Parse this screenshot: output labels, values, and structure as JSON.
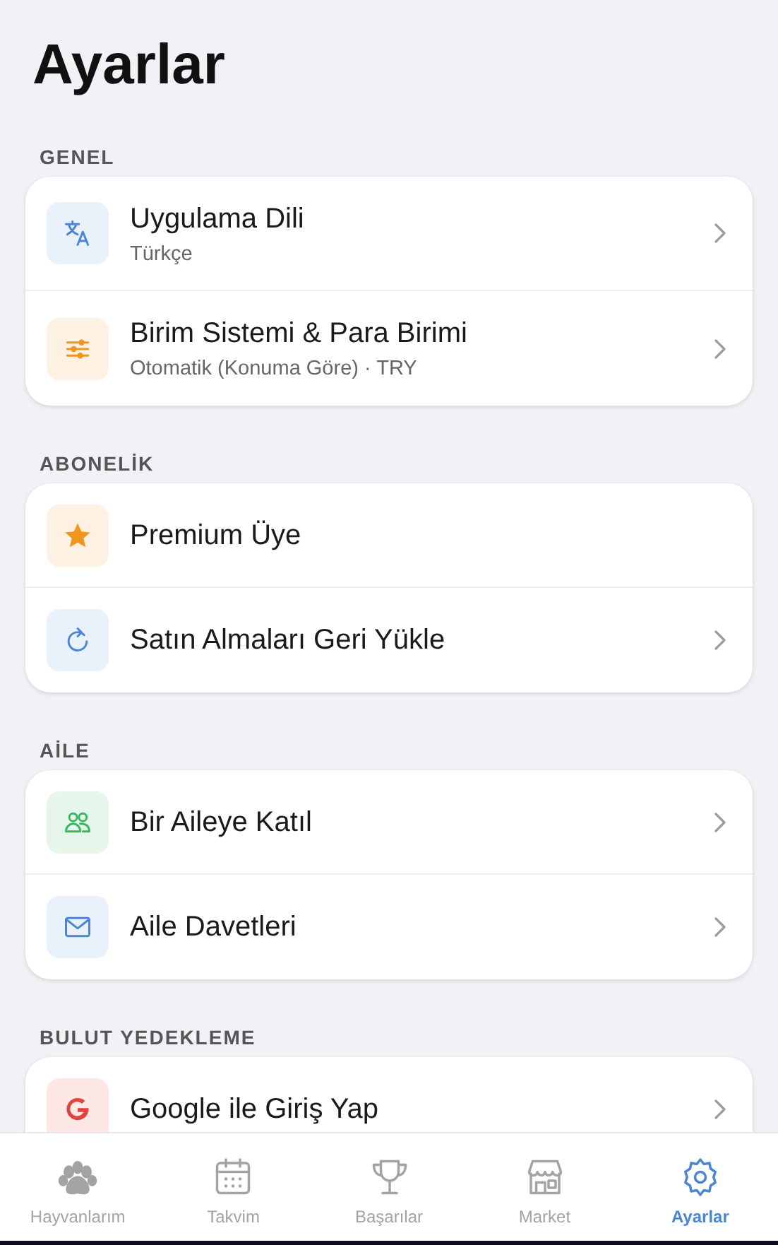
{
  "title": "Ayarlar",
  "sections": [
    {
      "header": "GENEL",
      "rows": [
        {
          "kind": "translate",
          "title": "Uygulama Dili",
          "subtitle": "Türkçe",
          "chevron": true
        },
        {
          "kind": "sliders",
          "title": "Birim Sistemi & Para Birimi",
          "subtitle": "Otomatik (Konuma Göre) · TRY",
          "chevron": true
        }
      ]
    },
    {
      "header": "ABONELİK",
      "rows": [
        {
          "kind": "star",
          "title": "Premium Üye",
          "chevron": false
        },
        {
          "kind": "refresh",
          "title": "Satın Almaları Geri Yükle",
          "chevron": true
        }
      ]
    },
    {
      "header": "AİLE",
      "rows": [
        {
          "kind": "people",
          "title": "Bir Aileye Katıl",
          "chevron": true
        },
        {
          "kind": "mail",
          "title": "Aile Davetleri",
          "chevron": true
        }
      ]
    },
    {
      "header": "BULUT YEDEKLEME",
      "rows": [
        {
          "kind": "google",
          "title": "Google ile Giriş Yap",
          "chevron": true
        }
      ]
    }
  ],
  "tab_bar": [
    {
      "kind": "paw",
      "label": "Hayvanlarım",
      "selected": false
    },
    {
      "kind": "calendar",
      "label": "Takvim",
      "selected": false
    },
    {
      "kind": "trophy",
      "label": "Başarılar",
      "selected": false
    },
    {
      "kind": "store",
      "label": "Market",
      "selected": false
    },
    {
      "kind": "gear",
      "label": "Ayarlar",
      "selected": true
    }
  ]
}
